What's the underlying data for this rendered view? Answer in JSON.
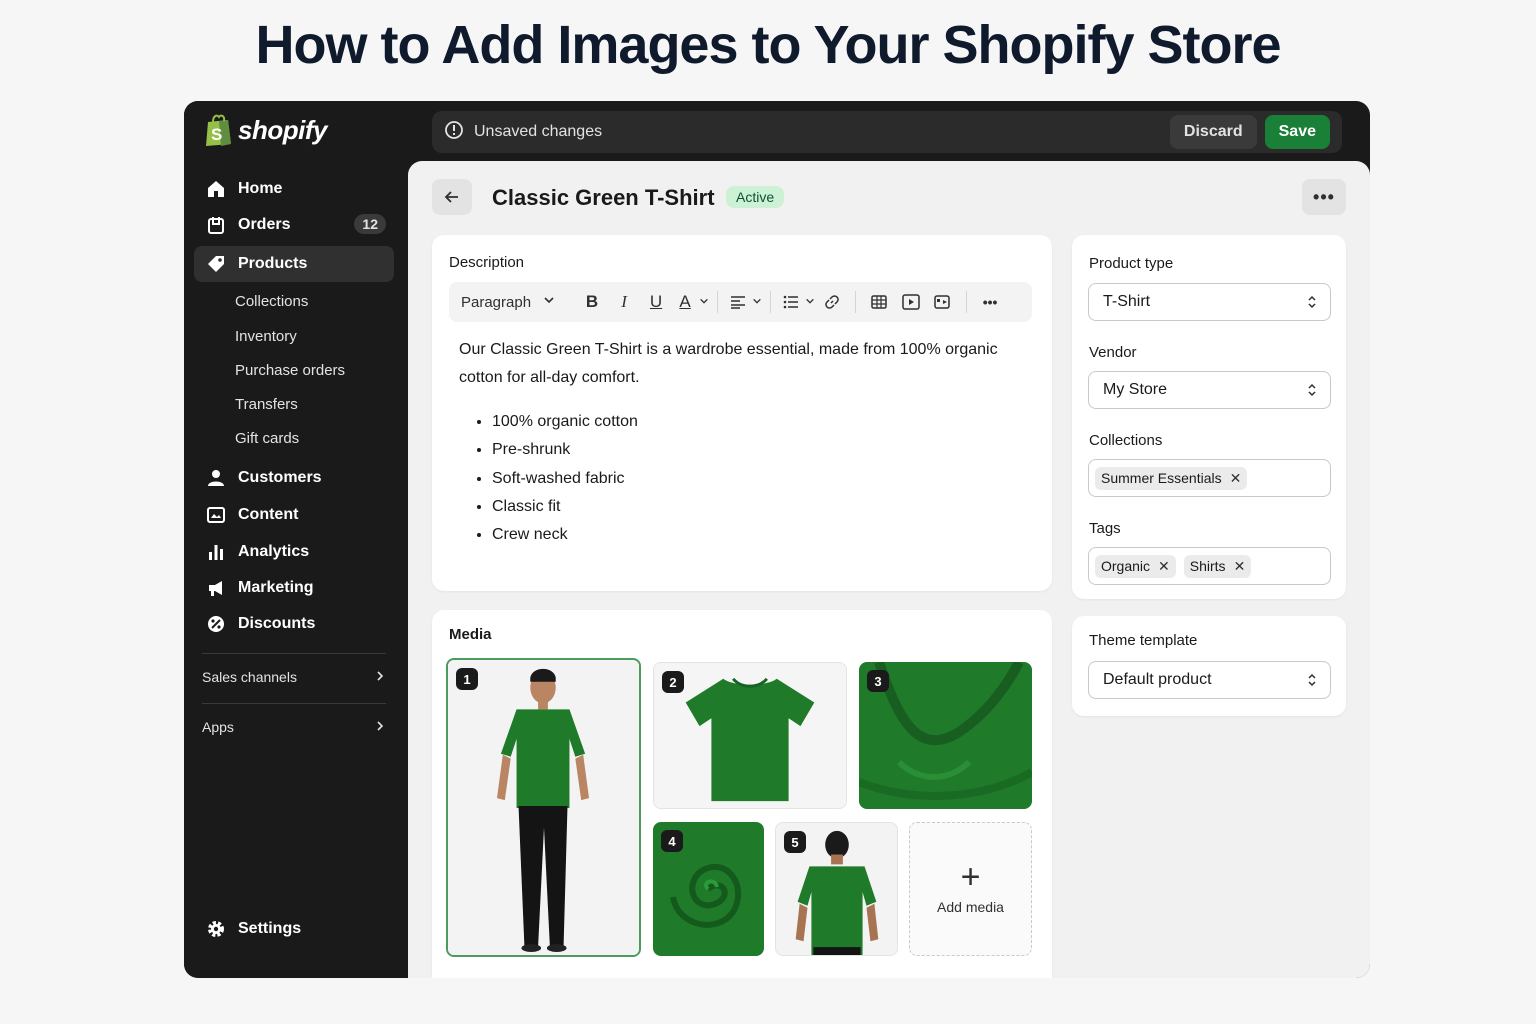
{
  "page": {
    "heading": "How to Add Images to Your Shopify Store"
  },
  "brand": {
    "name": "shopify",
    "green": "#95bf47",
    "save_green": "#1a7f37"
  },
  "sidebar": {
    "items": [
      {
        "label": "Home",
        "icon": "home-icon"
      },
      {
        "label": "Orders",
        "icon": "orders-icon",
        "badge": "12"
      },
      {
        "label": "Products",
        "icon": "tag-icon",
        "active": true
      },
      {
        "label": "Customers",
        "icon": "person-icon"
      },
      {
        "label": "Content",
        "icon": "content-icon"
      },
      {
        "label": "Analytics",
        "icon": "analytics-icon"
      },
      {
        "label": "Marketing",
        "icon": "megaphone-icon"
      },
      {
        "label": "Discounts",
        "icon": "discount-icon"
      }
    ],
    "product_subitems": [
      "Collections",
      "Inventory",
      "Purchase orders",
      "Transfers",
      "Gift cards"
    ],
    "sales_channels": "Sales channels",
    "apps": "Apps",
    "settings": "Settings"
  },
  "topbar": {
    "status": "Unsaved changes",
    "discard": "Discard",
    "save": "Save"
  },
  "product": {
    "title": "Classic Green T-Shirt",
    "status": "Active",
    "description_label": "Description",
    "toolbar_style": "Paragraph",
    "description": "Our Classic Green T-Shirt is a wardrobe essential, made from 100% organic cotton for all-day comfort.",
    "bullets": [
      "100% organic cotton",
      "Pre-shrunk",
      "Soft-washed fabric",
      "Classic fit",
      "Crew neck"
    ]
  },
  "media": {
    "label": "Media",
    "items": [
      {
        "num": "1",
        "subject": "model-front"
      },
      {
        "num": "2",
        "subject": "shirt-flat"
      },
      {
        "num": "3",
        "subject": "collar-closeup"
      },
      {
        "num": "4",
        "subject": "fabric-swirl"
      },
      {
        "num": "5",
        "subject": "model-back"
      }
    ],
    "add_label": "Add media"
  },
  "organization": {
    "product_type_label": "Product type",
    "product_type": "T-Shirt",
    "vendor_label": "Vendor",
    "vendor": "My Store",
    "collections_label": "Collections",
    "collections": [
      "Summer Essentials"
    ],
    "tags_label": "Tags",
    "tags": [
      "Organic",
      "Shirts"
    ]
  },
  "theme": {
    "label": "Theme template",
    "value": "Default product"
  }
}
